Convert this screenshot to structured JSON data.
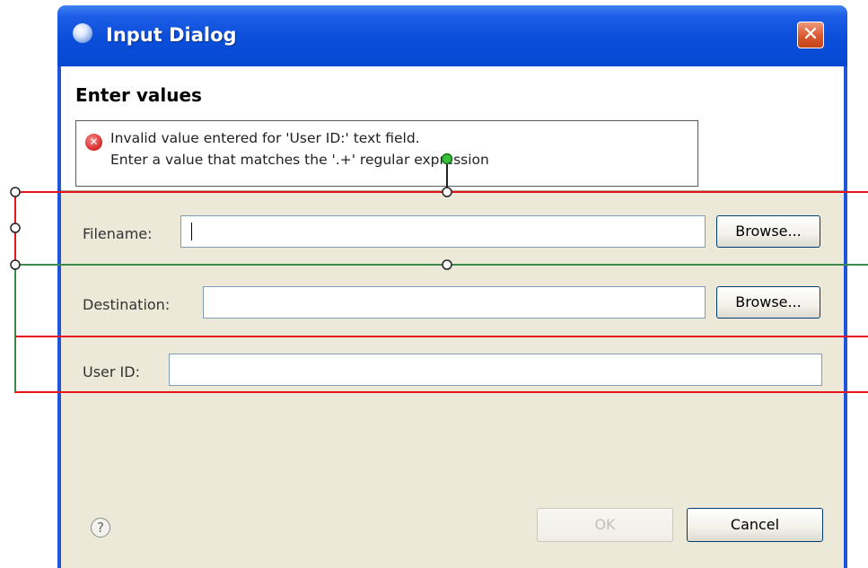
{
  "window": {
    "title": "Input Dialog",
    "close_glyph": "✕"
  },
  "header": {
    "title": "Enter values",
    "message_icon": "error-icon",
    "message_lines": [
      "Invalid value entered for 'User ID:' text field.",
      "Enter a value that matches the '.+' regular expression"
    ]
  },
  "form": {
    "filename": {
      "label": "Filename:",
      "value": "",
      "browse_label": "Browse..."
    },
    "destination": {
      "label": "Destination:",
      "value": "",
      "browse_label": "Browse..."
    },
    "user_id": {
      "label": "User ID:",
      "value": ""
    }
  },
  "footer": {
    "help_glyph": "?",
    "ok_label": "OK",
    "cancel_label": "Cancel"
  },
  "colors": {
    "title_bar": "#0a4ed9",
    "client_bg": "#ece9d8",
    "error": "#d42020",
    "overlay_red": "#e8141b",
    "overlay_green": "#3b8a4c"
  }
}
